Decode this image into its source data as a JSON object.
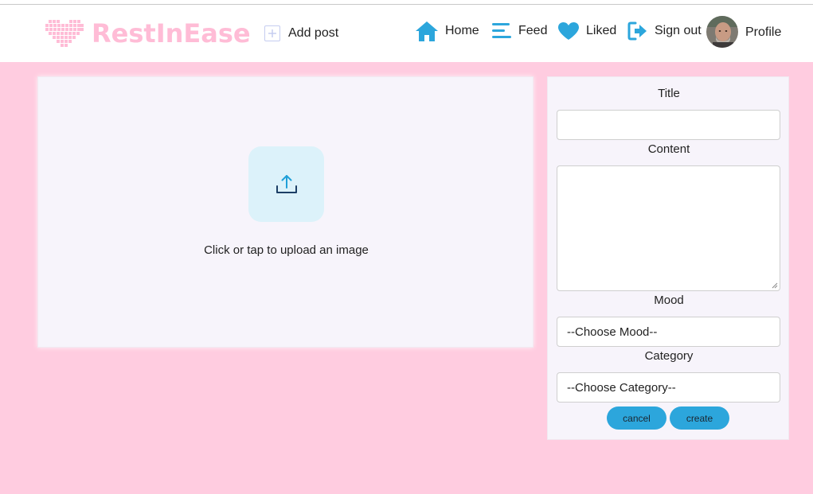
{
  "brand": {
    "name": "RestInEase",
    "logo_icon": "heart-icon",
    "color": "#ffbcd6"
  },
  "nav": {
    "add_post": "Add post",
    "home": "Home",
    "feed": "Feed",
    "liked": "Liked",
    "sign_out": "Sign out",
    "profile": "Profile",
    "accent_color": "#2ca6dc"
  },
  "upload": {
    "caption": "Click or tap to upload an image",
    "icon": "upload-icon"
  },
  "form": {
    "title_label": "Title",
    "title_value": "",
    "content_label": "Content",
    "content_value": "",
    "mood_label": "Mood",
    "mood_selected": "--Choose Mood--",
    "category_label": "Category",
    "category_selected": "--Choose Category--",
    "cancel_label": "cancel",
    "create_label": "create"
  },
  "colors": {
    "page_background": "#ffcce0",
    "panel_background": "#f7f4fb",
    "upload_box": "#dcf2fa"
  }
}
